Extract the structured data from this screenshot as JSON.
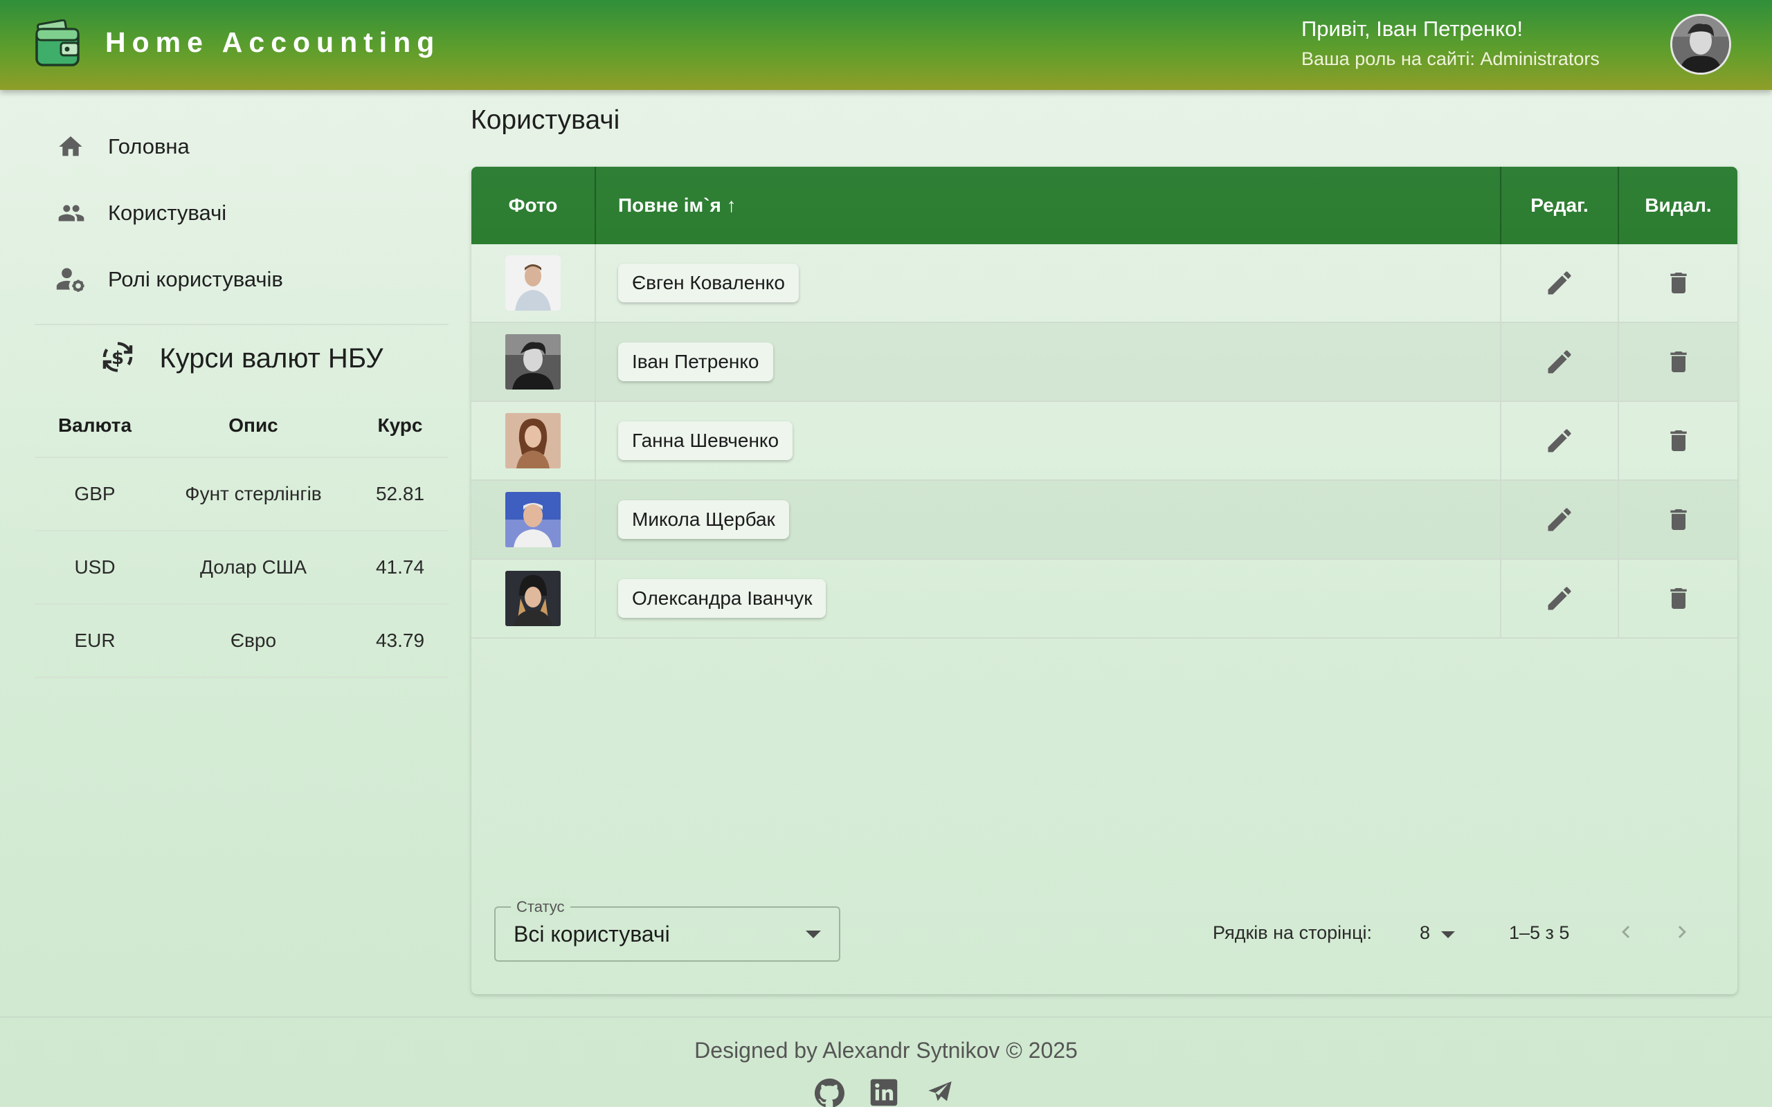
{
  "header": {
    "app_title": "Home Accounting",
    "greeting": "Привіт, Іван Петренко!",
    "role_line": "Ваша роль на сайті: Administrators",
    "logo_icon": "wallet-icon",
    "avatar_icon": "user-avatar"
  },
  "sidebar": {
    "items": [
      {
        "label": "Головна",
        "icon": "home-icon"
      },
      {
        "label": "Користувачі",
        "icon": "people-icon"
      },
      {
        "label": "Ролі користувачів",
        "icon": "user-settings-icon"
      }
    ],
    "rates": {
      "title": "Курси валют НБУ",
      "icon": "currency-exchange-icon",
      "headers": {
        "currency": "Валюта",
        "description": "Опис",
        "rate": "Курс"
      },
      "rows": [
        {
          "currency": "GBP",
          "description": "Фунт стерлінгів",
          "rate": "52.81"
        },
        {
          "currency": "USD",
          "description": "Долар США",
          "rate": "41.74"
        },
        {
          "currency": "EUR",
          "description": "Євро",
          "rate": "43.79"
        }
      ]
    }
  },
  "main": {
    "page_title": "Користувачі",
    "table": {
      "headers": {
        "photo": "Фото",
        "full_name": "Повне ім`я ↑",
        "edit": "Редаг.",
        "delete": "Видал."
      },
      "rows": [
        {
          "name": "Євген Коваленко"
        },
        {
          "name": "Іван Петренко"
        },
        {
          "name": "Ганна Шевченко"
        },
        {
          "name": "Микола Щербак"
        },
        {
          "name": "Олександра Іванчук"
        }
      ]
    },
    "status": {
      "legend": "Статус",
      "value": "Всі користувачі"
    },
    "pagination": {
      "rows_label": "Рядків на сторінці:",
      "rows_value": "8",
      "range": "1–5 з 5"
    }
  },
  "footer": {
    "text": "Designed by Alexandr Sytnikov © 2025",
    "icons": [
      "github-icon",
      "linkedin-icon",
      "telegram-icon"
    ]
  },
  "colors": {
    "header_start": "#2f8f3a",
    "header_end": "#8f9e28",
    "table_header": "#2f7f37",
    "icon_gray": "#5f5f5f"
  }
}
